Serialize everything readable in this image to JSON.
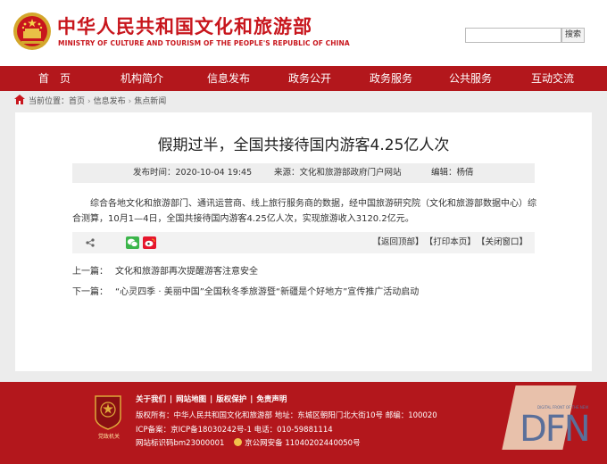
{
  "header": {
    "title": "中华人民共和国文化和旅游部",
    "subtitle": "MINISTRY OF CULTURE AND TOURISM OF THE PEOPLE'S REPUBLIC OF CHINA",
    "search_placeholder": "",
    "search_button": "搜索"
  },
  "nav": {
    "items": [
      {
        "label": "首　页"
      },
      {
        "label": "机构简介"
      },
      {
        "label": "信息发布"
      },
      {
        "label": "政务公开"
      },
      {
        "label": "政务服务"
      },
      {
        "label": "公共服务"
      },
      {
        "label": "互动交流"
      }
    ]
  },
  "breadcrumb": {
    "prefix": "当前位置：",
    "items": [
      "首页",
      "信息发布",
      "焦点新闻"
    ],
    "separator": "›"
  },
  "article": {
    "title": "假期过半，全国共接待国内游客4.25亿人次",
    "publish_time": "发布时间：2020-10-04 19:45",
    "source": "来源：文化和旅游部政府门户网站",
    "editor": "编辑：杨倩",
    "body": "综合各地文化和旅游部门、通讯运营商、线上旅行服务商的数据，经中国旅游研究院（文化和旅游部数据中心）综合测算，10月1—4日，全国共接待国内游客4.25亿人次，实现旅游收入3120.2亿元。"
  },
  "share": {
    "links": [
      "【返回顶部】",
      "【打印本页】",
      "【关闭窗口】"
    ]
  },
  "prev_next": {
    "prev_label": "上一篇：",
    "prev_title": "文化和旅游部再次提醒游客注意安全",
    "next_label": "下一篇：",
    "next_title": "“心灵四季 · 美丽中国”全国秋冬季旅游暨“新疆是个好地方”宣传推广活动启动"
  },
  "footer": {
    "links": [
      "关于我们",
      "网站地图",
      "版权保护",
      "免责声明"
    ],
    "copyright": "版权所有：中华人民共和国文化和旅游部 地址：东城区朝阳门北大街10号 邮编：100020",
    "icp": "ICP备案：京ICP备18030242号-1 电话：010-59881114",
    "site_id": "网站标识码bm23000001",
    "police": "京公网安备 11040202440050号",
    "badge_text": "党政机关"
  },
  "watermark": {
    "text": "DFN",
    "small": "DIGITAL FRONT OF THE NEW"
  },
  "colors": {
    "brand_red": "#c8161d",
    "nav_red": "#b3171c",
    "page_bg": "#ececec"
  }
}
